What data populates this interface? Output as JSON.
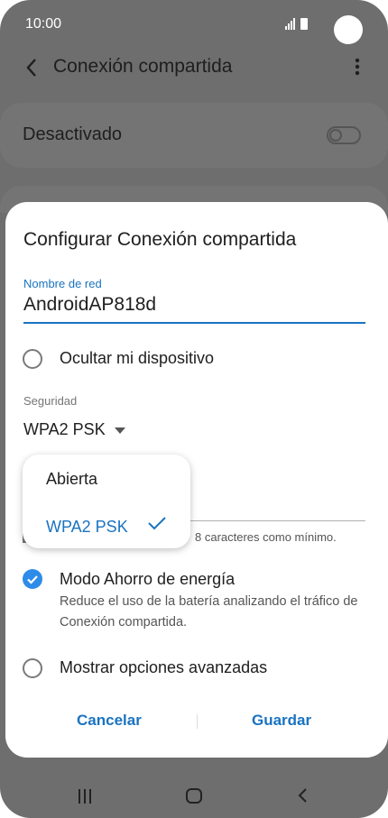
{
  "status_bar": {
    "time": "10:00"
  },
  "app_bar": {
    "title": "Conexión compartida"
  },
  "toggle_card": {
    "label": "Desactivado"
  },
  "dialog": {
    "title": "Configurar Conexión compartida",
    "network_name": {
      "label": "Nombre de red",
      "value": "AndroidAP818d"
    },
    "hide_device": {
      "label": "Ocultar mi dispositivo"
    },
    "security": {
      "label": "Seguridad",
      "value": "WPA2 PSK"
    },
    "password_hint": "8 caracteres como mínimo.",
    "power_saving": {
      "label": "Modo Ahorro de energía",
      "description": "Reduce el uso de la batería analizando el tráfico de Conexión compartida."
    },
    "advanced": {
      "label": "Mostrar opciones avanzadas"
    },
    "cancel_label": "Cancelar",
    "save_label": "Guardar"
  },
  "security_dropdown": {
    "options": [
      "Abierta",
      "WPA2 PSK"
    ],
    "selected": "WPA2 PSK"
  },
  "colors": {
    "accent": "#1a73c0",
    "checkbox": "#2d8ce8",
    "scrim": "#6e6e6e"
  }
}
